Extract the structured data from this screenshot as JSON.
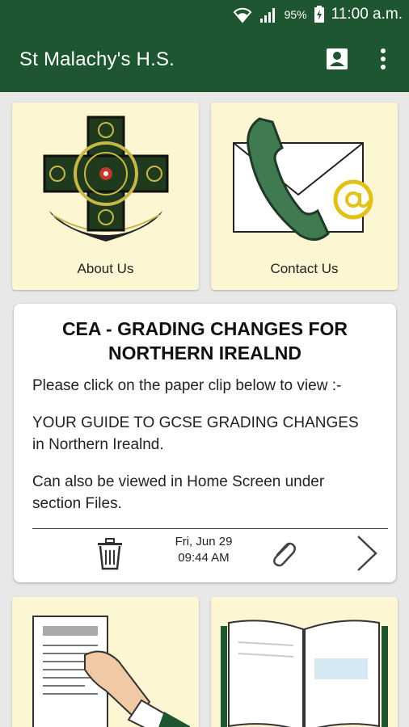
{
  "status_bar": {
    "battery_percent": "95%",
    "time": "11:00 a.m."
  },
  "app_bar": {
    "title": "St Malachy's H.S."
  },
  "tiles": [
    {
      "label": "About Us"
    },
    {
      "label": "Contact Us"
    }
  ],
  "news": {
    "title": "CEA - GRADING CHANGES FOR NORTHERN IREALND",
    "paragraphs": [
      "Please click on the paper clip below to view :-",
      "YOUR GUIDE TO GCSE GRADING CHANGES in Northern Irealnd.",
      "Can also be viewed in Home Screen under section Files."
    ],
    "date": "Fri, Jun 29",
    "time": "09:44 AM"
  },
  "colors": {
    "primary": "#1e5631",
    "tile_bg": "#fdf6d3",
    "background": "#e8e8e8"
  },
  "icons": {
    "contact": "contact-card-icon",
    "menu": "more-vert-icon",
    "delete": "trash-icon",
    "attachment": "paperclip-icon",
    "next": "chevron-right-icon"
  }
}
